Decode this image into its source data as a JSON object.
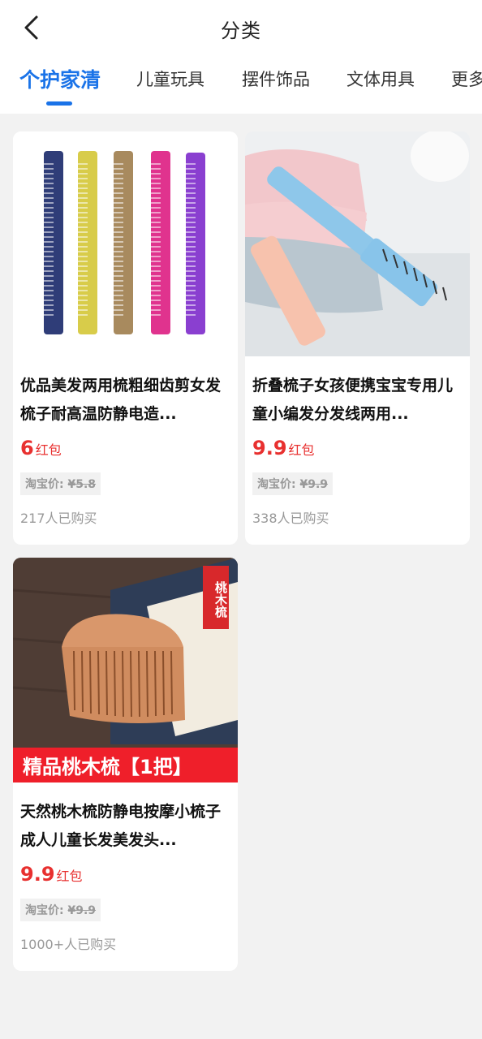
{
  "header": {
    "title": "分类",
    "back_icon": "chevron-left-icon"
  },
  "tabs": [
    {
      "label": "个护家清",
      "active": true
    },
    {
      "label": "儿童玩具",
      "active": false
    },
    {
      "label": "摆件饰品",
      "active": false
    },
    {
      "label": "文体用具",
      "active": false
    },
    {
      "label": "更多",
      "active": false
    }
  ],
  "colors": {
    "accent": "#1a73e8",
    "price": "#e8302f",
    "banner": "#ef1f2a"
  },
  "products": [
    {
      "name": "优品美发两用梳粗细齿剪女发梳子耐高温防静电造...",
      "price": "6",
      "price_unit": "红包",
      "taobao_label": "淘宝价:",
      "taobao_price": "¥5.8",
      "sold": "217人已购买"
    },
    {
      "name": "折叠梳子女孩便携宝宝专用儿童小编发分发线两用...",
      "price": "9.9",
      "price_unit": "红包",
      "taobao_label": "淘宝价:",
      "taobao_price": "¥9.9",
      "sold": "338人已购买"
    },
    {
      "name": "天然桃木梳防静电按摩小梳子成人儿童长发美发头...",
      "price": "9.9",
      "price_unit": "红包",
      "taobao_label": "淘宝价:",
      "taobao_price": "¥9.9",
      "sold": "1000+人已购买",
      "banner": "精品桃木梳【1把】",
      "seal": "桃木梳"
    }
  ]
}
